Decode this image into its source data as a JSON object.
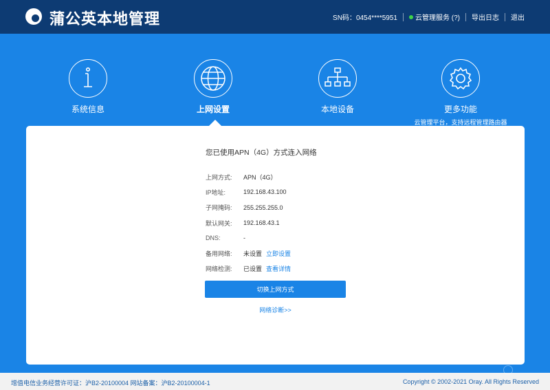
{
  "header": {
    "title": "蒲公英本地管理",
    "sn_label": "SN码：",
    "sn_value": "0454****5951",
    "cloud_service": "云管理服务 (?)",
    "export_log": "导出日志",
    "logout": "退出",
    "status_color": "#3fd34a"
  },
  "nav": {
    "items": [
      {
        "label": "系统信息",
        "icon": "info-icon"
      },
      {
        "label": "上网设置",
        "icon": "globe-icon",
        "active": true
      },
      {
        "label": "本地设备",
        "icon": "network-topology-icon"
      },
      {
        "label": "更多功能",
        "icon": "gear-icon",
        "sub": "云管理平台，支持远程管理路由器"
      }
    ]
  },
  "main": {
    "heading": "您已使用APN（4G）方式连入网络",
    "rows": [
      {
        "label": "上网方式:",
        "value": "APN（4G）"
      },
      {
        "label": "IP地址:",
        "value": "192.168.43.100"
      },
      {
        "label": "子网掩码:",
        "value": "255.255.255.0"
      },
      {
        "label": "默认网关:",
        "value": "192.168.43.1"
      },
      {
        "label": "DNS:",
        "value": "-"
      },
      {
        "label": "备用网络:",
        "value": "未设置",
        "link": "立即设置"
      },
      {
        "label": "网络检测:",
        "value": "已设置",
        "link": "查看详情"
      }
    ],
    "switch_button": "切换上网方式",
    "diagnose_link": "网络诊断>>"
  },
  "footer": {
    "license": "增值电信业务经营许可证：沪B2-20100004 网站备案：沪B2-20100004-1",
    "copyright": "Copyright © 2002-2021 Oray. All Rights Reserved"
  },
  "colors": {
    "accent": "#1a84e6",
    "topbar": "#0d3b73",
    "card": "#ffffff"
  }
}
